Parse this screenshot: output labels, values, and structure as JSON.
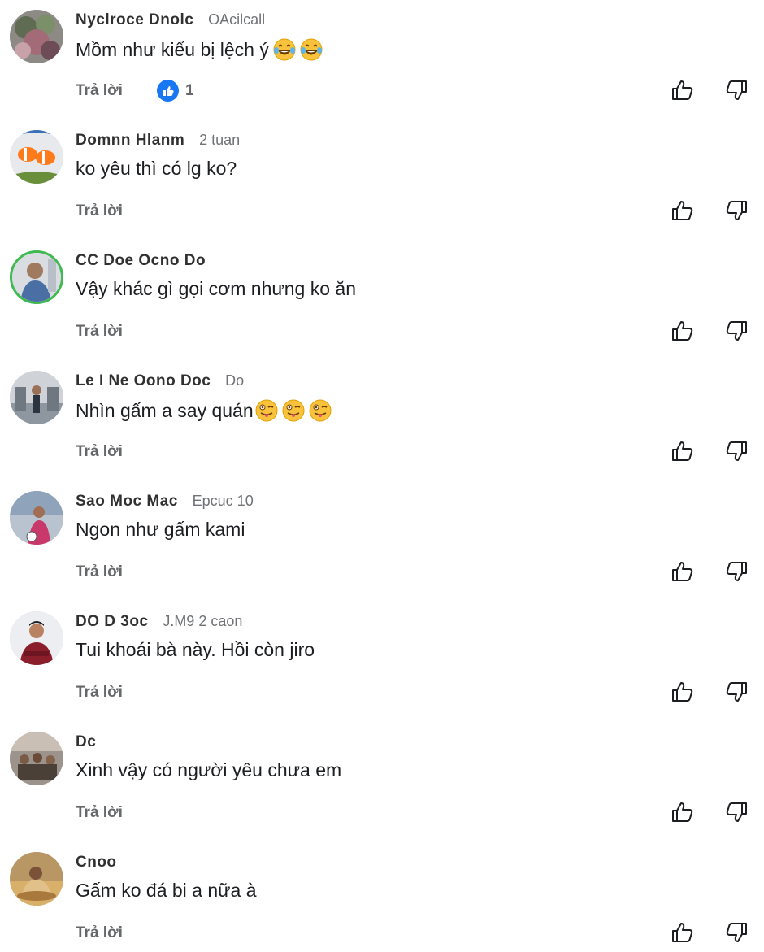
{
  "labels": {
    "reply": "Trả lời"
  },
  "icons": {
    "upvote": "thumb-up-outline-icon",
    "downvote": "thumb-down-outline-icon",
    "like_reaction": "like-reaction-icon"
  },
  "colors": {
    "secondary_text": "#65676b",
    "like_blue": "#1877f2"
  },
  "comments": [
    {
      "author": "Nyclroce Dnolc",
      "meta": "OAcilcall",
      "text": "Mồm như kiểu bị lệch ý",
      "emoji": [
        "laugh-tears-emoji",
        "laugh-tears-emoji"
      ],
      "reaction_count": "1"
    },
    {
      "author": "Domnn Hlanm",
      "meta": "2 tuan",
      "text": "ko yêu thì có lg ko?"
    },
    {
      "author": "CC Doe Ocno Do",
      "meta": "",
      "text": "Vậy khác gì gọi cơm nhưng ko ăn"
    },
    {
      "author": "Le I Ne Oono Doc",
      "meta": "Do",
      "text": "Nhìn gấm a say quán",
      "emoji": [
        "winking-tongue-emoji",
        "winking-tongue-emoji",
        "winking-tongue-emoji"
      ]
    },
    {
      "author": "Sao Moc Mac",
      "meta": "Epcuc 10",
      "text": "Ngon như gấm kami"
    },
    {
      "author": "DO D 3oc",
      "meta": "J.M9 2 caon",
      "text": "Tui khoái bà này. Hồi còn jiro"
    },
    {
      "author": "Dc",
      "meta": "",
      "text": "Xinh vậy có người yêu chưa em"
    },
    {
      "author": "Cnoo",
      "meta": "",
      "text": "Gấm ko đá bi a nữa à"
    }
  ]
}
